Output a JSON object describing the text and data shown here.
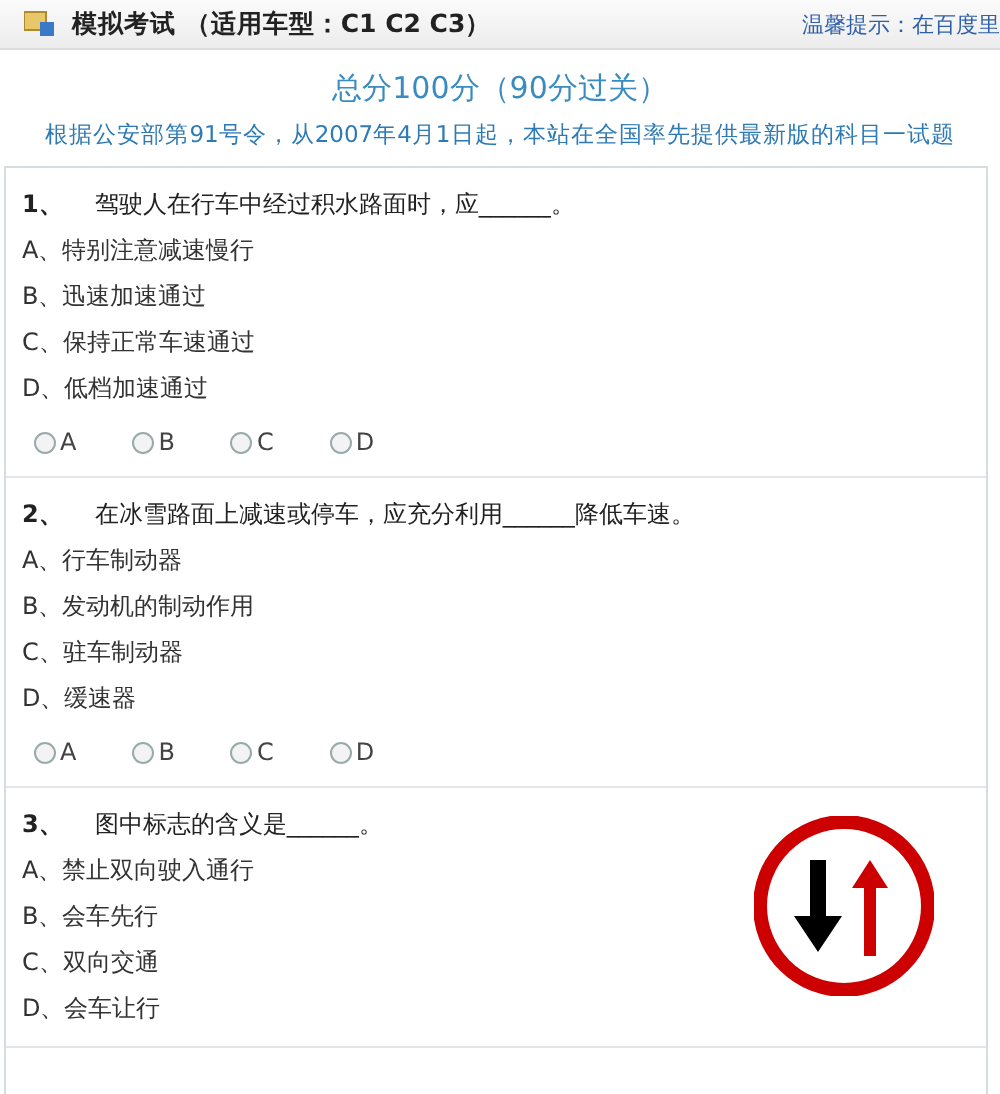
{
  "header": {
    "title": "模拟考试 （适用车型：C1 C2 C3）",
    "hint": "温馨提示：在百度里"
  },
  "score": "总分100分（90分过关）",
  "notice": "根据公安部第91号令，从2007年4月1日起，本站在全国率先提供最新版的科目一试题",
  "questions": [
    {
      "number": "1、",
      "text": "驾驶人在行车中经过积水路面时，应______。",
      "options": [
        "A、特别注意减速慢行",
        "B、迅速加速通过",
        "C、保持正常车速通过",
        "D、低档加速通过"
      ],
      "radios": [
        {
          "label": "A",
          "selected": false
        },
        {
          "label": "B",
          "selected": false
        },
        {
          "label": "C",
          "selected": false
        },
        {
          "label": "D",
          "selected": false
        }
      ]
    },
    {
      "number": "2、",
      "text": "在冰雪路面上减速或停车，应充分利用______降低车速。",
      "options": [
        "A、行车制动器",
        "B、发动机的制动作用",
        "C、驻车制动器",
        "D、缓速器"
      ],
      "radios": [
        {
          "label": "A",
          "selected": false
        },
        {
          "label": "B",
          "selected": false
        },
        {
          "label": "C",
          "selected": false
        },
        {
          "label": "D",
          "selected": false
        }
      ]
    },
    {
      "number": "3、",
      "text": "图中标志的含义是______。",
      "options": [
        "A、禁止双向驶入通行",
        "B、会车先行",
        "C、双向交通",
        "D、会车让行"
      ],
      "sign": true
    }
  ]
}
